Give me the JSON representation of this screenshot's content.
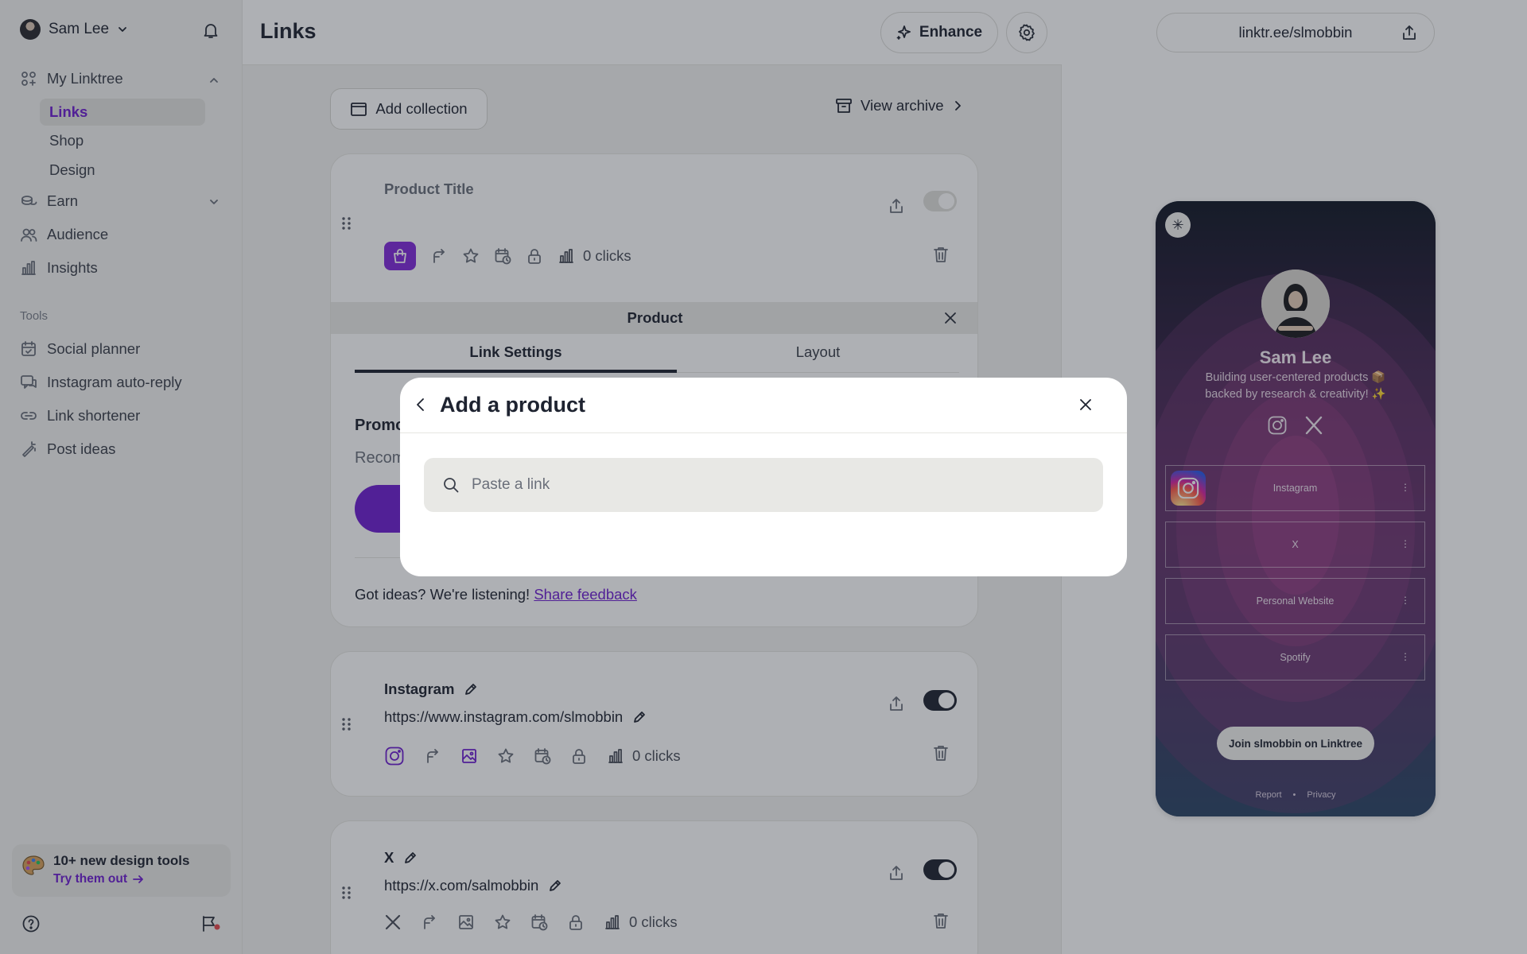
{
  "sidebar": {
    "user_name": "Sam Lee",
    "nav": {
      "my_linktree": "My Linktree",
      "links": "Links",
      "shop": "Shop",
      "design": "Design",
      "earn": "Earn",
      "audience": "Audience",
      "insights": "Insights"
    },
    "tools_label": "Tools",
    "tools": {
      "social_planner": "Social planner",
      "instagram_auto_reply": "Instagram auto-reply",
      "link_shortener": "Link shortener",
      "post_ideas": "Post ideas"
    },
    "promo": {
      "title": "10+ new design tools",
      "cta": "Try them out"
    }
  },
  "main": {
    "title": "Links",
    "enhance_label": "Enhance",
    "add_collection_label": "Add collection",
    "view_archive_label": "View archive",
    "product_card": {
      "title": "Product Title",
      "clicks": "0 clicks",
      "enabled": false,
      "panel_title": "Product",
      "tabs": [
        "Link Settings",
        "Layout"
      ],
      "active_tab": "Link Settings",
      "promo_heading": "Promo",
      "promo_sub": "Recom",
      "feedback_text": "Got ideas? We're listening!",
      "feedback_link": "Share feedback"
    },
    "instagram_card": {
      "title": "Instagram",
      "url": "https://www.instagram.com/slmobbin",
      "clicks": "0 clicks",
      "enabled": true
    },
    "x_card": {
      "title": "X",
      "url": "https://x.com/salmobbin",
      "clicks": "0 clicks",
      "enabled": true
    }
  },
  "preview": {
    "url": "linktr.ee/slmobbin",
    "name": "Sam Lee",
    "bio_line1": "Building user-centered products 📦",
    "bio_line2": "backed by research & creativity! ✨",
    "links": [
      "Instagram",
      "X",
      "Personal Website",
      "Spotify"
    ],
    "join_label": "Join slmobbin on Linktree",
    "footer": {
      "report": "Report",
      "separator": "•",
      "privacy": "Privacy"
    }
  },
  "modal": {
    "title": "Add a product",
    "search_placeholder": "Paste a link"
  },
  "colors": {
    "accent": "#6e1fd1",
    "shop_tile": "#8129d9",
    "overlay": "rgba(30,35,48,0.36)"
  }
}
